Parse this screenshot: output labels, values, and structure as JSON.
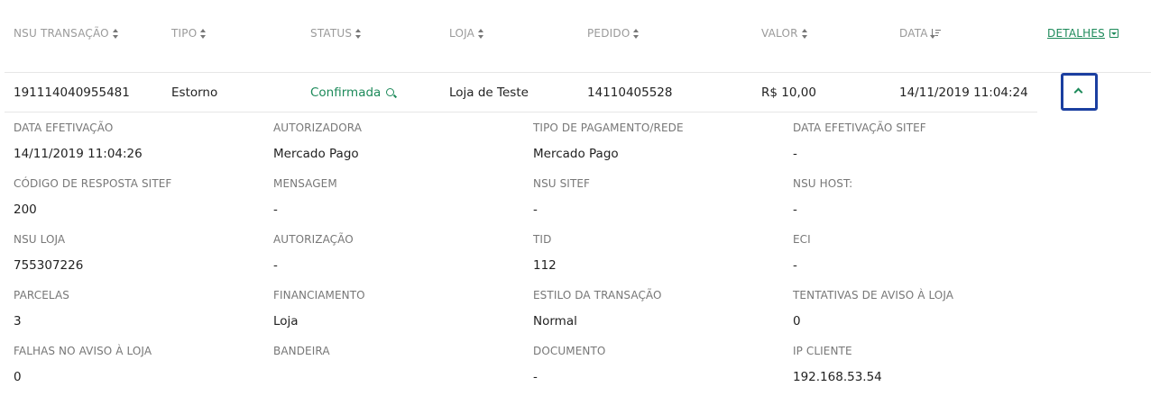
{
  "header": {
    "columns": [
      {
        "label": "NSU TRANSAÇÃO"
      },
      {
        "label": "TIPO"
      },
      {
        "label": "STATUS"
      },
      {
        "label": "LOJA"
      },
      {
        "label": "PEDIDO"
      },
      {
        "label": "VALOR"
      },
      {
        "label": "DATA"
      },
      {
        "label": "DETALHES"
      }
    ]
  },
  "row": {
    "nsu": "191114040955481",
    "tipo": "Estorno",
    "status": "Confirmada",
    "loja": "Loja de Teste",
    "pedido": "14110405528",
    "valor": "R$ 10,00",
    "data": "14/11/2019 11:04:24"
  },
  "details": [
    {
      "label": "DATA EFETIVAÇÃO",
      "value": "14/11/2019 11:04:26"
    },
    {
      "label": "AUTORIZADORA",
      "value": "Mercado Pago"
    },
    {
      "label": "TIPO DE PAGAMENTO/REDE",
      "value": "Mercado Pago"
    },
    {
      "label": "DATA EFETIVAÇÃO SITEF",
      "value": "-"
    },
    {
      "label": "CÓDIGO DE RESPOSTA SITEF",
      "value": "200"
    },
    {
      "label": "MENSAGEM",
      "value": "-"
    },
    {
      "label": "NSU SITEF",
      "value": "-"
    },
    {
      "label": "NSU HOST:",
      "value": "-"
    },
    {
      "label": "NSU LOJA",
      "value": "755307226"
    },
    {
      "label": "AUTORIZAÇÃO",
      "value": "-"
    },
    {
      "label": "TID",
      "value": "112"
    },
    {
      "label": "ECI",
      "value": "-"
    },
    {
      "label": "PARCELAS",
      "value": "3"
    },
    {
      "label": "FINANCIAMENTO",
      "value": "Loja"
    },
    {
      "label": "ESTILO DA TRANSAÇÃO",
      "value": "Normal"
    },
    {
      "label": "TENTATIVAS DE AVISO À LOJA",
      "value": "0"
    },
    {
      "label": "FALHAS NO AVISO À LOJA",
      "value": "0"
    },
    {
      "label": "BANDEIRA",
      "value": ""
    },
    {
      "label": "DOCUMENTO",
      "value": "-"
    },
    {
      "label": "IP CLIENTE",
      "value": "192.168.53.54"
    }
  ],
  "colors": {
    "accent": "#1d8a5a",
    "focus_border": "#1b3fa0",
    "header_text": "#9a9a9a"
  }
}
